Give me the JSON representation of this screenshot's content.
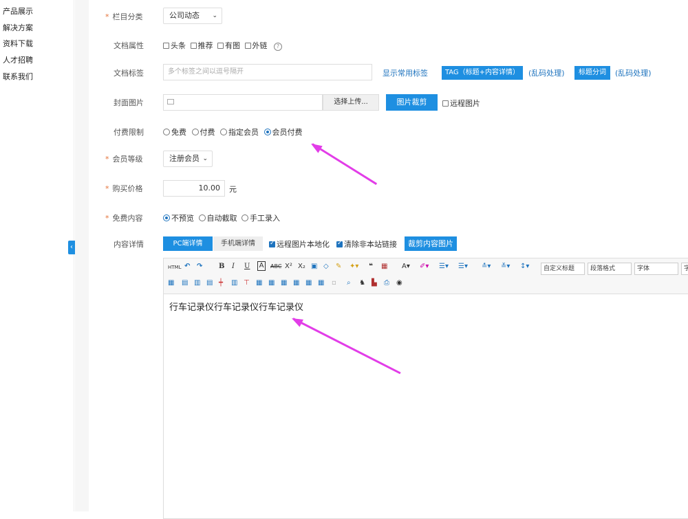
{
  "sidebar": {
    "items": [
      {
        "label": "产品展示"
      },
      {
        "label": "解决方案"
      },
      {
        "label": "资料下载"
      },
      {
        "label": "人才招聘"
      },
      {
        "label": "联系我们"
      }
    ]
  },
  "form": {
    "category": {
      "required": "*",
      "label": "栏目分类",
      "value": "公司动态",
      "chev": "⌄"
    },
    "attributes": {
      "label": "文档属性",
      "options": [
        {
          "label": "头条"
        },
        {
          "label": "推荐"
        },
        {
          "label": "有图"
        },
        {
          "label": "外链"
        }
      ],
      "help": "?"
    },
    "tags": {
      "label": "文档标签",
      "placeholder": "多个标签之间以逗号隔开",
      "show_common": "显示常用标签",
      "tag_button": "TAG（标题+内容详情）",
      "garbled1": "(乱码处理)",
      "title_seg_button": "标题分词",
      "garbled2": "(乱码处理)"
    },
    "cover": {
      "label": "封面图片",
      "upload": "选择上传...",
      "crop": "图片裁剪",
      "remote": "远程图片"
    },
    "payment": {
      "label": "付费限制",
      "options": [
        {
          "label": "免费"
        },
        {
          "label": "付费"
        },
        {
          "label": "指定会员"
        },
        {
          "label": "会员付费"
        }
      ],
      "selected": 3
    },
    "member_level": {
      "required": "*",
      "label": "会员等级",
      "value": "注册会员",
      "chev": "⌄"
    },
    "price": {
      "required": "*",
      "label": "购买价格",
      "value": "10.00",
      "unit": "元"
    },
    "free_content": {
      "required": "*",
      "label": "免费内容",
      "options": [
        {
          "label": "不预览"
        },
        {
          "label": "自动截取"
        },
        {
          "label": "手工录入"
        }
      ],
      "selected": 0
    },
    "content": {
      "label": "内容详情",
      "tab_pc": "PC端详情",
      "tab_mobile": "手机端详情",
      "localize": "远程图片本地化",
      "remove_links": "清除非本站链接",
      "crop_images": "裁剪内容图片"
    }
  },
  "editor": {
    "toolbar": {
      "html": "HTML",
      "custom_title": "自定义标题",
      "para_format": "段落格式",
      "font": "字体",
      "font_size": "字"
    },
    "body_text": "行车记录仪行车记录仪行车记录仪"
  },
  "collapse_icon": "‹",
  "colors": {
    "accent": "#1e8fe1",
    "arrow": "#e23de8",
    "required": "#e5733a"
  }
}
